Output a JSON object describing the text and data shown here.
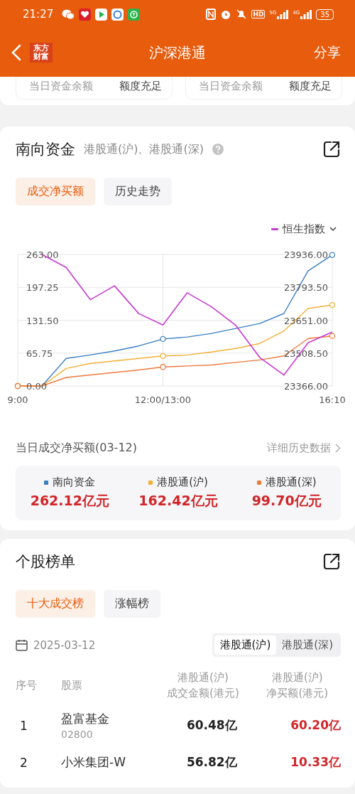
{
  "status_bar": {
    "time": "21:27",
    "hd": "HD",
    "networks": [
      "5G",
      "4G"
    ],
    "battery": "35"
  },
  "nav": {
    "logo": "东方财富",
    "title": "沪深港通",
    "action": "分享"
  },
  "quota_cards": [
    {
      "label": "当日资金余额",
      "value": "额度充足"
    },
    {
      "label": "当日资金余额",
      "value": "额度充足"
    }
  ],
  "southbound": {
    "title": "南向资金",
    "subtitle": "港股通(沪)、港股通(深)",
    "tabs": [
      {
        "label": "成交净买额",
        "selected": true
      },
      {
        "label": "历史走势",
        "selected": false
      }
    ],
    "chart_data": {
      "type": "line",
      "categories": [
        "9:00",
        null,
        null,
        null,
        null,
        null,
        "12:00/13:00",
        null,
        null,
        null,
        null,
        null,
        null,
        "16:10"
      ],
      "ylim": [
        0,
        263
      ],
      "grid": true,
      "yticks": [
        {
          "value": 0,
          "label": "0.00"
        },
        {
          "value": 65.75,
          "label": "65.75"
        },
        {
          "value": 131.5,
          "label": "131.50"
        },
        {
          "value": 197.25,
          "label": "197.25"
        },
        {
          "value": 263,
          "label": "263.00"
        }
      ],
      "y2lim": [
        23366,
        23936
      ],
      "y2ticks": [
        {
          "value": 23366,
          "label": "23366.00"
        },
        {
          "value": 23508.5,
          "label": "23508.50"
        },
        {
          "value": 23651,
          "label": "23651.00"
        },
        {
          "value": 23793.5,
          "label": "23793.50"
        },
        {
          "value": 23936,
          "label": "23936.00"
        }
      ],
      "series": [
        {
          "name": "南向资金",
          "color": "#3b7fc4",
          "values": [
            0,
            0,
            55,
            62,
            70,
            80,
            94,
            98,
            105,
            115,
            125,
            145,
            230,
            262
          ]
        },
        {
          "name": "港股通(沪)",
          "color": "#f2b035",
          "values": [
            0,
            0,
            35,
            45,
            50,
            55,
            60,
            62,
            68,
            75,
            85,
            110,
            155,
            162
          ]
        },
        {
          "name": "港股通(深)",
          "color": "#ec7a3c",
          "values": [
            0,
            0,
            17,
            22,
            27,
            32,
            38,
            40,
            42,
            47,
            52,
            60,
            95,
            100
          ]
        },
        {
          "name": "恒生指数",
          "color": "#c83ad0",
          "axis": "y2",
          "values": [
            null,
            23936,
            23880,
            23740,
            23800,
            23680,
            23630,
            23770,
            23710,
            23630,
            23490,
            23413,
            23553,
            23600
          ]
        }
      ]
    },
    "summary": {
      "title": "当日成交净买额(03-12)",
      "link": "详细历史数据",
      "items": [
        {
          "value": "262.12亿元"
        },
        {
          "value": "162.42亿元"
        },
        {
          "value": "99.70亿元"
        }
      ]
    }
  },
  "stock_ranking": {
    "title": "个股榜单",
    "tabs": [
      {
        "label": "十大成交榜",
        "selected": true
      },
      {
        "label": "涨幅榜",
        "selected": false
      }
    ],
    "date": "2025-03-12",
    "segments": [
      {
        "label": "港股通(沪)",
        "selected": true
      },
      {
        "label": "港股通(深)",
        "selected": false
      }
    ],
    "columns": [
      "序号",
      "股票",
      "港股通(沪)\n成交金额(港元)",
      "港股通(沪)\n净买额(港元)"
    ],
    "rows": [
      {
        "rank": "1",
        "name": "盈富基金",
        "code": "02800",
        "turnover": "60.48亿",
        "net_buy": "60.20亿"
      },
      {
        "rank": "2",
        "name": "小米集团-W",
        "turnover": "56.82亿",
        "net_buy": "10.33亿"
      }
    ]
  }
}
